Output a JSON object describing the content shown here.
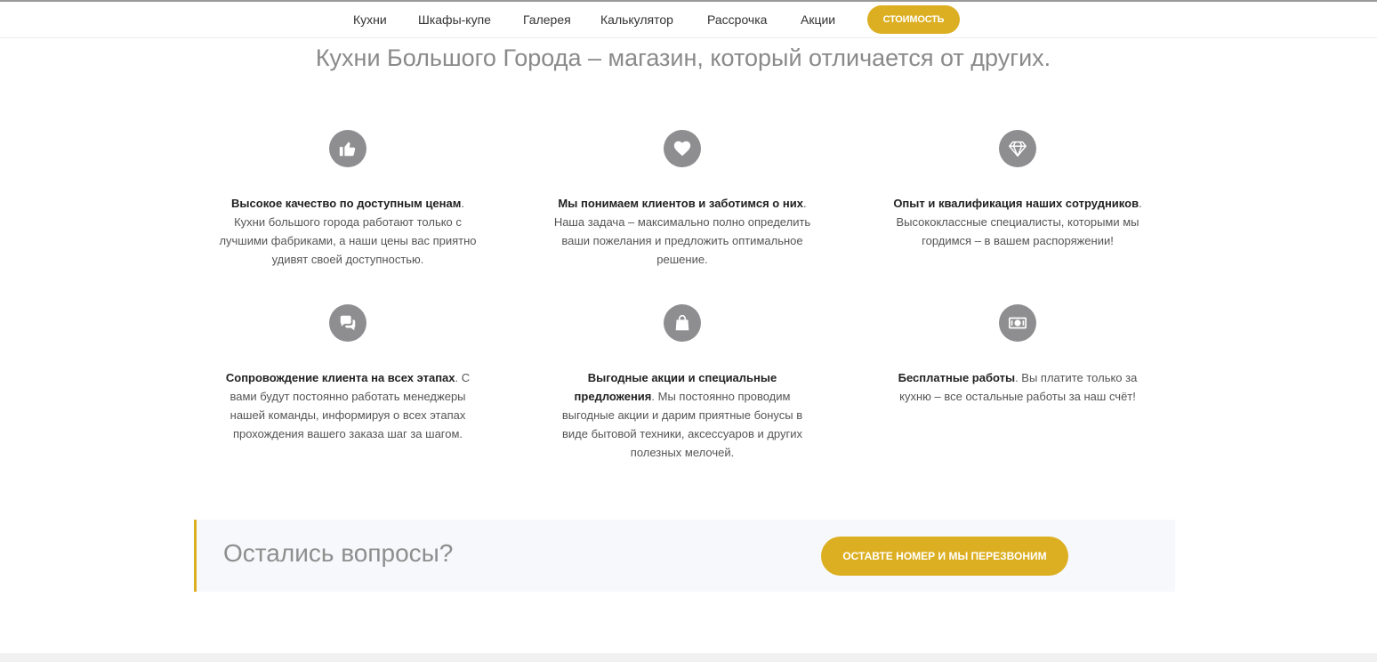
{
  "nav": {
    "items": [
      {
        "label": "Кухни"
      },
      {
        "label": "Шкафы-купе"
      },
      {
        "label": "Галерея"
      },
      {
        "label": "Калькулятор"
      },
      {
        "label": "Рассрочка"
      },
      {
        "label": "Акции"
      }
    ],
    "cta_label": "СТОИМОСТЬ"
  },
  "headline": "Кухни Большого Города – магазин, который отличается от других.",
  "features": [
    {
      "icon": "thumbs-up-icon",
      "title": "Высокое качество по доступным ценам",
      "body": ". Кухни большого города работают только с лучшими фабриками, а наши цены вас приятно удивят своей доступностью."
    },
    {
      "icon": "heart-icon",
      "title": "Мы понимаем клиентов и заботимся о них",
      "body": ". Наша задача – максимально полно определить ваши пожелания и предложить оптимальное решение."
    },
    {
      "icon": "diamond-icon",
      "title": "Опыт и квалификация наших сотрудников",
      "body": ". Высококлассные специалисты, которыми мы гордимся – в вашем распоряжении!"
    },
    {
      "icon": "chat-bubbles-icon",
      "title": "Сопровождение клиента на всех этапах",
      "body": ". С вами будут постоянно работать менеджеры нашей команды, информируя о всех этапах прохождения вашего заказа шаг за шагом."
    },
    {
      "icon": "shopping-bag-icon",
      "title": "Выгодные акции и специальные предложения",
      "body": ". Мы постоянно проводим выгодные акции и дарим приятные бонусы в виде бытовой техники, аксессуаров и других полезных мелочей."
    },
    {
      "icon": "money-bill-icon",
      "title": "Бесплатные работы",
      "body": ". Вы платите только за кухню – все остальные работы за наш счёт!"
    }
  ],
  "cta": {
    "title": "Остались вопросы?",
    "button_label": "ОСТАВТЕ НОМЕР И МЫ ПЕРЕЗВОНИМ"
  },
  "colors": {
    "accent": "#dcaf22",
    "icon_bg": "#8e8e90",
    "headline": "#8a8a8a"
  }
}
